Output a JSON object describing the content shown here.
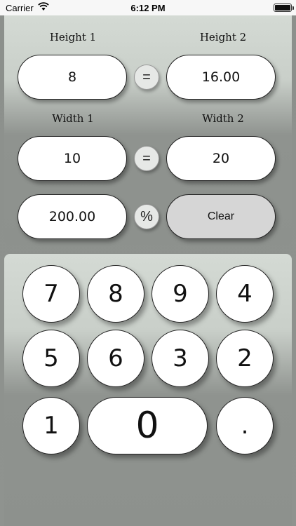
{
  "status_bar": {
    "carrier": "Carrier",
    "time": "6:12 PM"
  },
  "ratio": {
    "height1_label": "Height 1",
    "height2_label": "Height 2",
    "height1_value": "8",
    "height2_value": "16.00",
    "width1_label": "Width 1",
    "width2_label": "Width 2",
    "width1_value": "10",
    "width2_value": "20",
    "equals_1": "=",
    "equals_2": "=",
    "percent_value": "200.00",
    "percent_symbol": "%",
    "clear_label": "Clear"
  },
  "keypad": {
    "k7": "7",
    "k8": "8",
    "k9": "9",
    "k4": "4",
    "k5": "5",
    "k6": "6",
    "k3": "3",
    "k2": "2",
    "k1": "1",
    "k0": "0",
    "kdot": "."
  }
}
